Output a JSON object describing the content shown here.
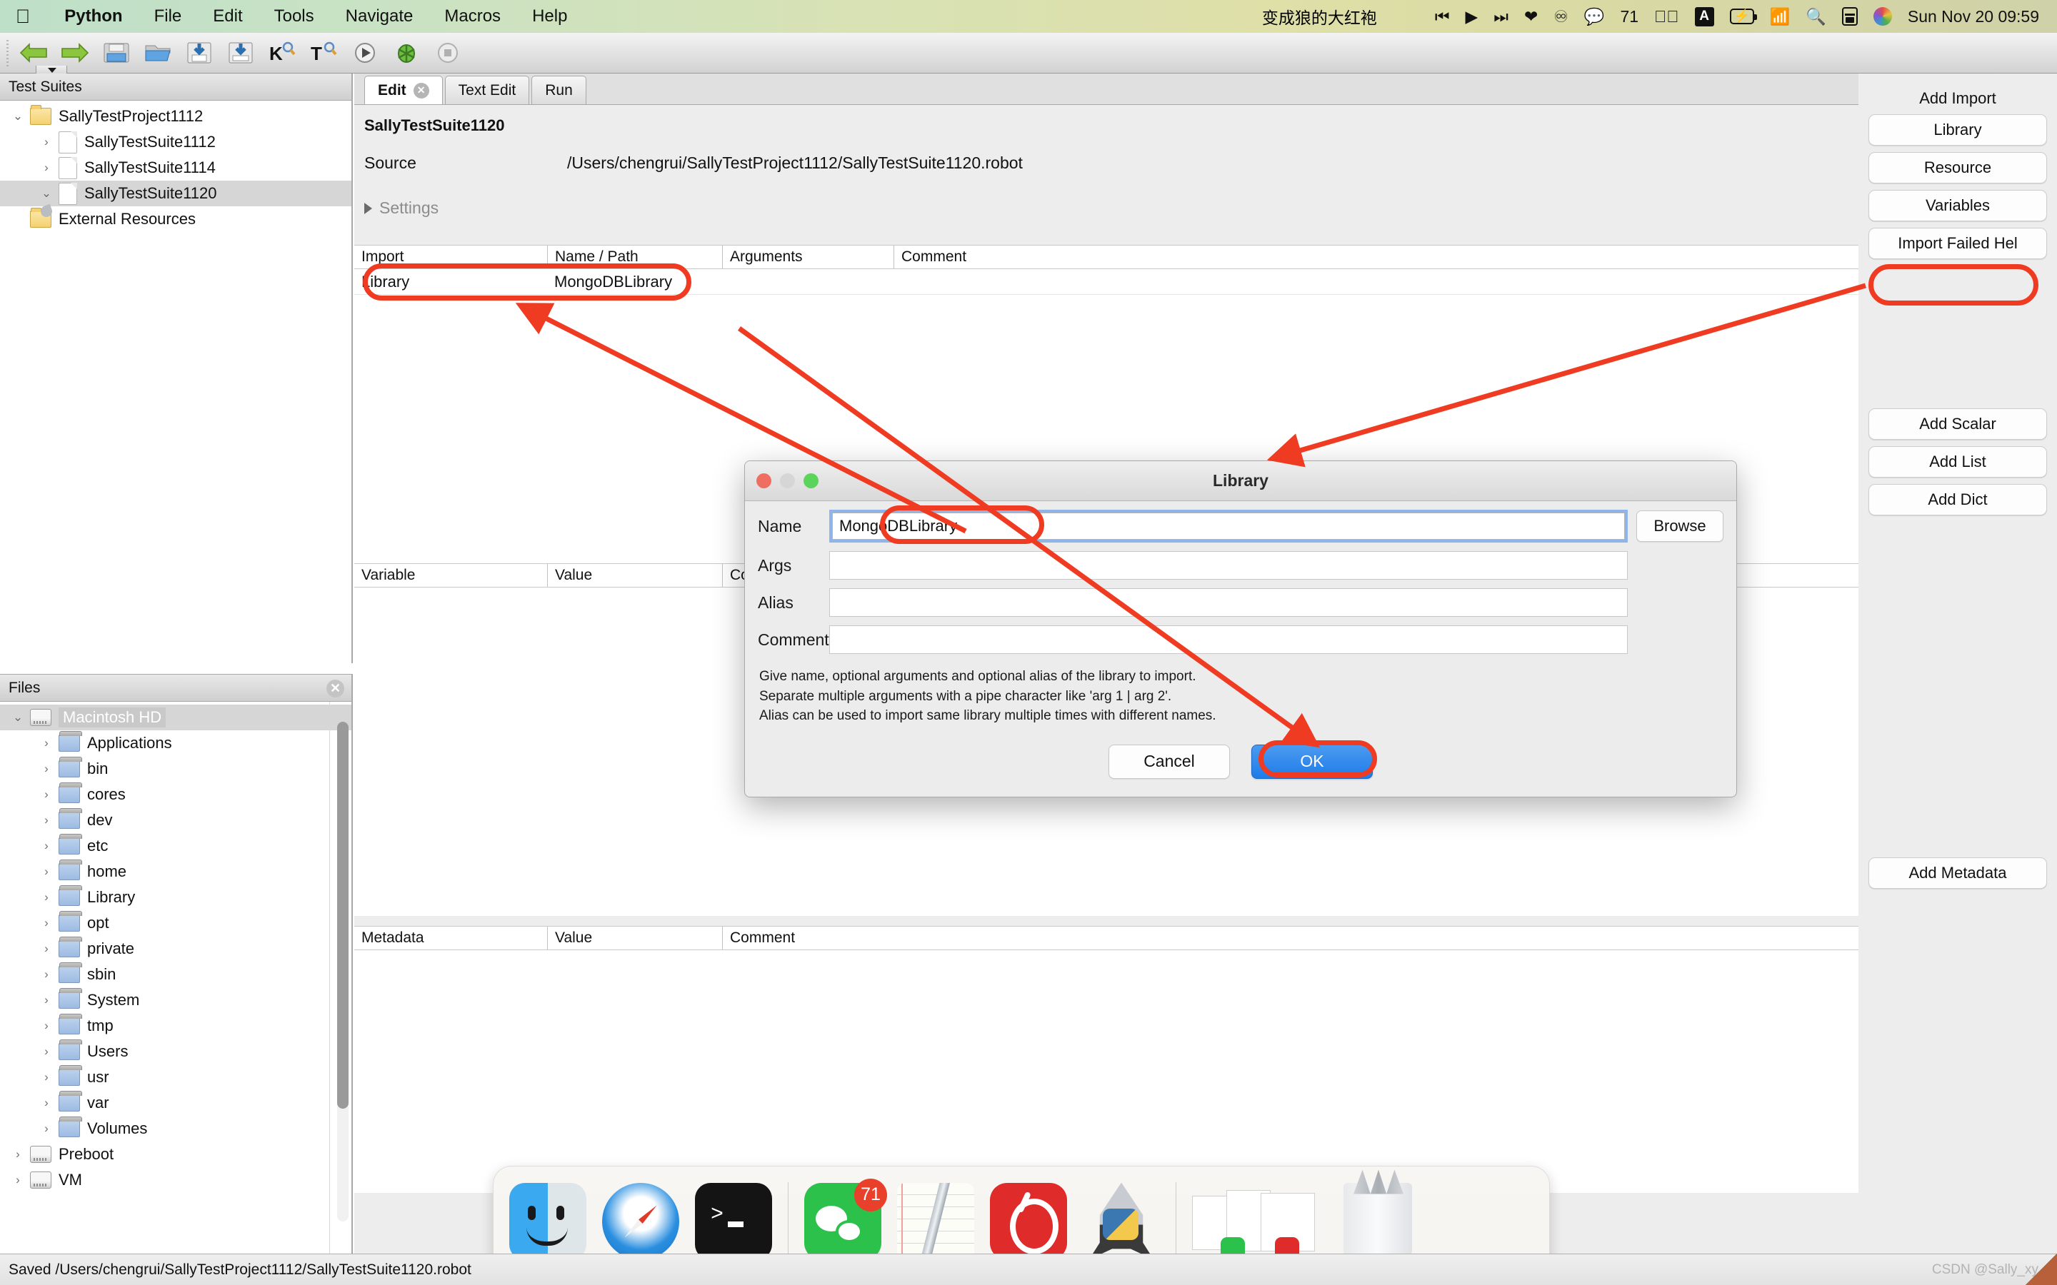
{
  "menubar": {
    "apple_icon": "apple-icon",
    "app_name": "Python",
    "items": [
      "File",
      "Edit",
      "Tools",
      "Navigate",
      "Macros",
      "Help"
    ],
    "user_name": "变成狼的大红袍",
    "status_icons": [
      "previous-track-icon",
      "play-icon",
      "next-track-icon",
      "heart-icon",
      "netease-music-icon",
      "wechat-icon"
    ],
    "wechat_count": "71",
    "extra_icons": [
      "screen-record-icon",
      "input-source-icon",
      "battery-charging-icon",
      "wifi-icon",
      "search-icon",
      "control-center-icon",
      "color-wheel-icon"
    ],
    "input_source_label": "A",
    "clock": "Sun Nov 20  09:59"
  },
  "toolbar": {
    "icons": [
      "back-arrow-icon",
      "forward-arrow-icon",
      "new-file-icon",
      "open-folder-icon",
      "save-icon",
      "save-as-icon",
      "search-keyword-icon",
      "search-test-icon",
      "run-icon",
      "debug-icon",
      "stop-icon"
    ]
  },
  "suites_panel": {
    "title": "Test Suites",
    "tree": [
      {
        "label": "SallyTestProject1112",
        "indent": 0,
        "twisty": "⌄",
        "icon": "folder-icon",
        "selected": false
      },
      {
        "label": "SallyTestSuite1112",
        "indent": 1,
        "twisty": "›",
        "icon": "file-icon",
        "selected": false
      },
      {
        "label": "SallyTestSuite1114",
        "indent": 1,
        "twisty": "›",
        "icon": "file-icon",
        "selected": false
      },
      {
        "label": "SallyTestSuite1120",
        "indent": 1,
        "twisty": "⌄",
        "icon": "file-icon",
        "selected": true
      },
      {
        "label": "External Resources",
        "indent": 0,
        "twisty": "",
        "icon": "folder-key-icon",
        "selected": false
      }
    ]
  },
  "files_panel": {
    "title": "Files",
    "close_icon": "close-icon",
    "tree": [
      {
        "label": "Macintosh HD",
        "indent": 0,
        "twisty": "⌄",
        "icon": "disk-icon",
        "selected": true
      },
      {
        "label": "Applications",
        "indent": 1,
        "twisty": "›",
        "icon": "folder-blue-icon",
        "selected": false
      },
      {
        "label": "bin",
        "indent": 1,
        "twisty": "›",
        "icon": "folder-blue-icon",
        "selected": false
      },
      {
        "label": "cores",
        "indent": 1,
        "twisty": "›",
        "icon": "folder-blue-icon",
        "selected": false
      },
      {
        "label": "dev",
        "indent": 1,
        "twisty": "›",
        "icon": "folder-blue-icon",
        "selected": false
      },
      {
        "label": "etc",
        "indent": 1,
        "twisty": "›",
        "icon": "folder-blue-icon",
        "selected": false
      },
      {
        "label": "home",
        "indent": 1,
        "twisty": "›",
        "icon": "folder-blue-icon",
        "selected": false
      },
      {
        "label": "Library",
        "indent": 1,
        "twisty": "›",
        "icon": "folder-blue-icon",
        "selected": false
      },
      {
        "label": "opt",
        "indent": 1,
        "twisty": "›",
        "icon": "folder-blue-icon",
        "selected": false
      },
      {
        "label": "private",
        "indent": 1,
        "twisty": "›",
        "icon": "folder-blue-icon",
        "selected": false
      },
      {
        "label": "sbin",
        "indent": 1,
        "twisty": "›",
        "icon": "folder-blue-icon",
        "selected": false
      },
      {
        "label": "System",
        "indent": 1,
        "twisty": "›",
        "icon": "folder-blue-icon",
        "selected": false
      },
      {
        "label": "tmp",
        "indent": 1,
        "twisty": "›",
        "icon": "folder-blue-icon",
        "selected": false
      },
      {
        "label": "Users",
        "indent": 1,
        "twisty": "›",
        "icon": "folder-blue-icon",
        "selected": false
      },
      {
        "label": "usr",
        "indent": 1,
        "twisty": "›",
        "icon": "folder-blue-icon",
        "selected": false
      },
      {
        "label": "var",
        "indent": 1,
        "twisty": "›",
        "icon": "folder-blue-icon",
        "selected": false
      },
      {
        "label": "Volumes",
        "indent": 1,
        "twisty": "›",
        "icon": "folder-blue-icon",
        "selected": false
      },
      {
        "label": "Preboot",
        "indent": 0,
        "twisty": "›",
        "icon": "disk-icon",
        "selected": false
      },
      {
        "label": "VM",
        "indent": 0,
        "twisty": "›",
        "icon": "disk-icon",
        "selected": false
      }
    ]
  },
  "editor": {
    "tabs": [
      {
        "label": "Edit",
        "active": true,
        "has_close": true
      },
      {
        "label": "Text Edit",
        "active": false,
        "has_close": false
      },
      {
        "label": "Run",
        "active": false,
        "has_close": false
      }
    ],
    "suite_name": "SallyTestSuite1120",
    "source_label": "Source",
    "source_value": "/Users/chengrui/SallyTestProject1112/SallyTestSuite1120.robot",
    "settings_label": "Settings",
    "import_table": {
      "headers": [
        "Import",
        "Name / Path",
        "Arguments",
        "Comment"
      ],
      "rows": [
        {
          "import": "Library",
          "name": "MongoDBLibrary",
          "arguments": "",
          "comment": ""
        }
      ]
    },
    "variable_table": {
      "headers": [
        "Variable",
        "Value",
        "Comment"
      ],
      "rows": []
    },
    "metadata_table": {
      "headers": [
        "Metadata",
        "Value",
        "Comment"
      ],
      "rows": []
    }
  },
  "rail": {
    "add_import_title": "Add Import",
    "import_buttons": [
      "Library",
      "Resource",
      "Variables",
      "Import Failed Hel"
    ],
    "variable_buttons": [
      "Add Scalar",
      "Add List",
      "Add Dict"
    ],
    "metadata_buttons": [
      "Add Metadata"
    ]
  },
  "dialog": {
    "title": "Library",
    "window_controls": [
      "close-button",
      "minimize-button",
      "maximize-button"
    ],
    "fields": [
      {
        "label": "Name",
        "value": "MongoDBLibrary",
        "focused": true
      },
      {
        "label": "Args",
        "value": "",
        "focused": false
      },
      {
        "label": "Alias",
        "value": "",
        "focused": false
      },
      {
        "label": "Comment",
        "value": "",
        "focused": false
      }
    ],
    "browse_label": "Browse",
    "help_lines": [
      "Give name, optional arguments and optional alias of the library to import.",
      "Separate multiple arguments with a pipe character like 'arg 1 | arg 2'.",
      "Alias can be used to import same library multiple times with different names."
    ],
    "cancel_label": "Cancel",
    "ok_label": "OK"
  },
  "statusbar": {
    "message": "Saved /Users/chengrui/SallyTestProject1112/SallyTestSuite1120.robot"
  },
  "watermark": "CSDN @Sally_xy",
  "dock": {
    "items": [
      {
        "name": "finder",
        "badge": "",
        "running": true
      },
      {
        "name": "safari",
        "badge": "",
        "running": true
      },
      {
        "name": "terminal",
        "badge": "",
        "running": true
      },
      {
        "name": "wechat",
        "badge": "71",
        "running": true
      },
      {
        "name": "notes",
        "badge": "",
        "running": false
      },
      {
        "name": "netease-music",
        "badge": "",
        "running": true
      },
      {
        "name": "pycharm-rocket",
        "badge": "",
        "running": true
      },
      {
        "name": "minimized-windows",
        "badge": "",
        "running": false
      },
      {
        "name": "trash",
        "badge": "",
        "running": false
      }
    ]
  },
  "colors": {
    "annotation_red": "#ef3b21",
    "accent_blue": "#2b7fe0",
    "selection_gray": "#d6d6d6"
  }
}
